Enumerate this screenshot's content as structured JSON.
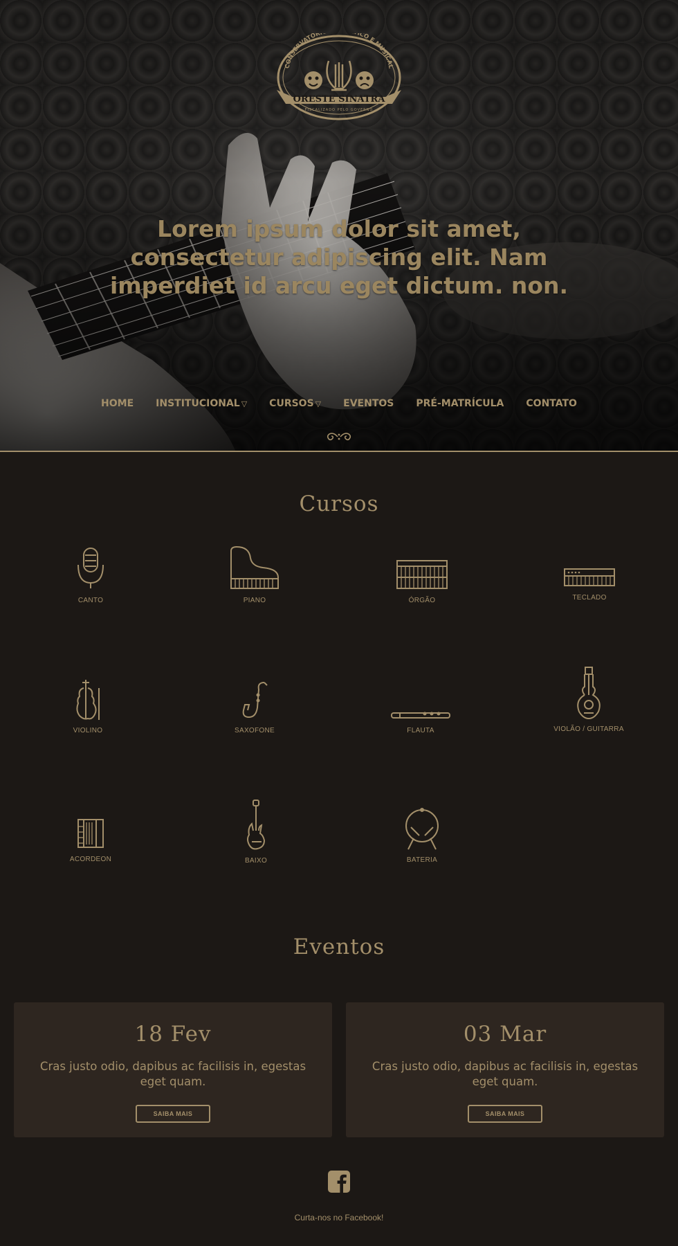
{
  "hero": {
    "logo": {
      "arc_text": "CONSERVATÓRIO DRAMÁTICO E MUSICAL",
      "name": "ORESTE SINATRA",
      "subtitle": "FISCALIZADO PELO GOVERNO"
    },
    "heading": "Lorem ipsum dolor sit amet, consectetur adipiscing elit. Nam imperdiet id arcu eget dictum. non."
  },
  "nav": {
    "items": [
      {
        "label": "HOME",
        "dropdown": false
      },
      {
        "label": "INSTITUCIONAL",
        "dropdown": true
      },
      {
        "label": "CURSOS",
        "dropdown": true
      },
      {
        "label": "EVENTOS",
        "dropdown": false
      },
      {
        "label": "PRÉ-MATRÍCULA",
        "dropdown": false
      },
      {
        "label": "CONTATO",
        "dropdown": false
      }
    ],
    "caret": "▽"
  },
  "cursos": {
    "title": "Cursos",
    "items": [
      {
        "label": "CANTO",
        "icon": "microphone-icon"
      },
      {
        "label": "PIANO",
        "icon": "piano-icon"
      },
      {
        "label": "ÓRGÃO",
        "icon": "organ-icon"
      },
      {
        "label": "TECLADO",
        "icon": "keyboard-icon"
      },
      {
        "label": "VIOLINO",
        "icon": "violin-icon"
      },
      {
        "label": "SAXOFONE",
        "icon": "saxophone-icon"
      },
      {
        "label": "FLAUTA",
        "icon": "flute-icon"
      },
      {
        "label": "VIOLÃO / GUITARRA",
        "icon": "guitar-icon"
      },
      {
        "label": "ACORDEON",
        "icon": "accordion-icon"
      },
      {
        "label": "BAIXO",
        "icon": "bass-icon"
      },
      {
        "label": "BATERIA",
        "icon": "drum-icon"
      }
    ]
  },
  "eventos": {
    "title": "Eventos",
    "cards": [
      {
        "date": "18 Fev",
        "text": "Cras justo odio, dapibus ac facilisis in, egestas eget quam.",
        "button": "SAIBA MAIS"
      },
      {
        "date": "03 Mar",
        "text": "Cras justo odio, dapibus ac facilisis in, egestas eget quam.",
        "button": "SAIBA MAIS"
      }
    ]
  },
  "footer": {
    "facebook_icon": "facebook-icon",
    "facebook_text": "Curta-nos no Facebook!"
  },
  "colors": {
    "background": "#1c1815",
    "accent": "#a38f6a",
    "card": "#2e2620"
  }
}
